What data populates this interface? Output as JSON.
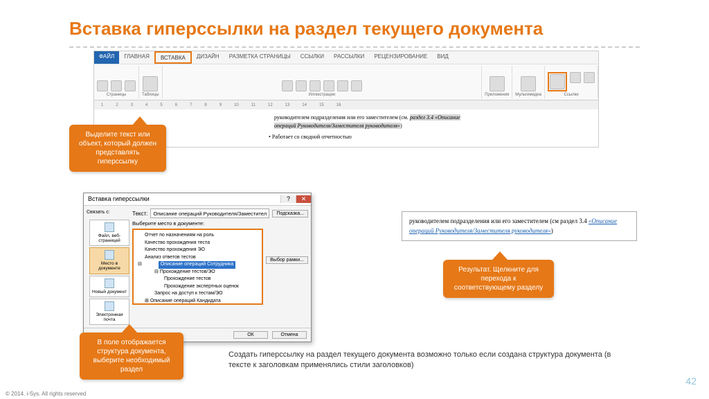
{
  "title": "Вставка гиперссылки на раздел текущего документа",
  "ribbon": {
    "tabs": [
      "ФАЙЛ",
      "ГЛАВНАЯ",
      "ВСТАВКА",
      "ДИЗАЙН",
      "РАЗМЕТКА СТРАНИЦЫ",
      "ССЫЛКИ",
      "РАССЫЛКИ",
      "РЕЦЕНЗИРОВАНИЕ",
      "ВИД"
    ],
    "groups": {
      "pages": {
        "label": "Страницы",
        "items": [
          "Титульная страница",
          "Пустая страница",
          "Разрыв страницы"
        ]
      },
      "tables": {
        "label": "Таблицы",
        "item": "Таблица"
      },
      "illustrations": {
        "label": "Иллюстрации",
        "items": [
          "Рисунки",
          "Изображения из Интернета",
          "Фигуры",
          "SmartArt",
          "Диаграмма",
          "Снимок"
        ]
      },
      "apps": {
        "label": "Приложения",
        "item": "Приложения для Office"
      },
      "media": {
        "label": "Мультимедиа",
        "item": "Видео из Интернета"
      },
      "links": {
        "label": "Ссылки",
        "items": [
          "Гиперссылка",
          "Закладка",
          "Перекрестная ссылка"
        ]
      }
    }
  },
  "ruler_marks": [
    "1",
    "2",
    "3",
    "4",
    "5",
    "6",
    "7",
    "8",
    "9",
    "10",
    "11",
    "12",
    "13",
    "14",
    "15",
    "16"
  ],
  "doc_snippet": {
    "line1a": "руководителем подразделения или его заместителем (см.",
    "line1b": "раздел 3.4 «Описание",
    "line2": "операций Руководителя/Заместителя руководителя»",
    "bullet": "Работает со сводной отчетностью"
  },
  "callouts": {
    "c1": "Выделите текст или объект, который должен представлять гиперссылку",
    "c2": "В поле отображается структура документа, выберите необходимый раздел",
    "c3": "Результат. Щелкните для перехода к соответствующему разделу"
  },
  "dialog": {
    "title": "Вставка гиперссылки",
    "link_to": "Связать с:",
    "side": {
      "s1": "Файл, веб-страницей",
      "s2": "Место в документе",
      "s3": "Новый документ",
      "s4": "Электронная почта"
    },
    "text_label": "Текст:",
    "text_value": "Описание операций Руководителя/Заместителя руководителя",
    "hint_btn": "Подсказка...",
    "select_label": "Выберите место в документе:",
    "frame_btn": "Выбор рамки...",
    "tree": [
      "Отчет по назначениям на роль",
      "Качество прохождения теста",
      "Качество прохождения ЭО",
      "Анализ ответов тестов",
      "Описание операций Сотрудника",
      "Прохождение тестов/ЭО",
      "Прохождение тестов",
      "Прохождение экспертных оценок",
      "Запрос на доступ к тестам/ЭО",
      "Описание операций Кандидата"
    ],
    "ok": "ОК",
    "cancel": "Отмена"
  },
  "result": {
    "t1": "руководителем подразделения или его заместителем (см раздел 3.4 ",
    "link": "«Описание операций Руководителя/Заместителя руководителя»",
    "t2": ")"
  },
  "bottom_text": "Создать гиперссылку на раздел текущего документа возможно только если создана структура документа (в тексте к заголовкам применялись стили заголовков)",
  "page": "42",
  "copy": "© 2014. i-Sys. All rights reserved"
}
